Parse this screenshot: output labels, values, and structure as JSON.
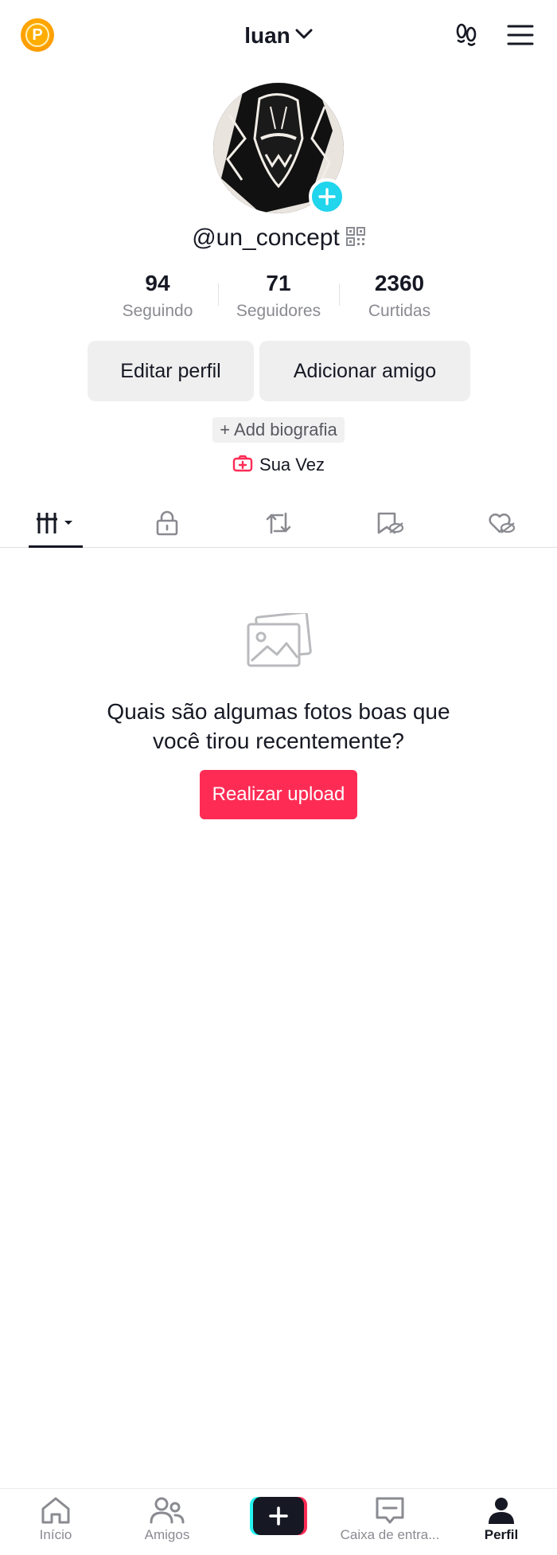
{
  "header": {
    "account_name": "luan",
    "icons": [
      "promo-points-icon",
      "chevron-down-icon",
      "footprints-icon",
      "menu-icon"
    ],
    "promo_letter": "P"
  },
  "profile": {
    "username": "@un_concept",
    "stats": [
      {
        "value": "94",
        "label": "Seguindo"
      },
      {
        "value": "71",
        "label": "Seguidores"
      },
      {
        "value": "2360",
        "label": "Curtidas"
      }
    ],
    "edit_label": "Editar perfil",
    "add_friend_label": "Adicionar amigo",
    "add_bio_label": "+ Add biografia",
    "turn_label": "Sua Vez"
  },
  "tabs": [
    {
      "name": "videos-grid",
      "icon": "grid-bars-icon",
      "active": true
    },
    {
      "name": "private",
      "icon": "lock-icon"
    },
    {
      "name": "reposts",
      "icon": "repost-icon"
    },
    {
      "name": "hidden-favorites",
      "icon": "bookmark-hidden-icon"
    },
    {
      "name": "hidden-liked",
      "icon": "heart-hidden-icon"
    }
  ],
  "empty_state": {
    "title": "Quais são algumas fotos boas que você tirou recentemente?",
    "button_label": "Realizar upload"
  },
  "bottom_nav": {
    "items": [
      {
        "label": "Início",
        "icon": "home-icon"
      },
      {
        "label": "Amigos",
        "icon": "friends-icon"
      },
      {
        "label": "",
        "icon": "plus-icon"
      },
      {
        "label": "Caixa de entra...",
        "icon": "inbox-icon"
      },
      {
        "label": "Perfil",
        "icon": "profile-icon",
        "active": true
      }
    ]
  },
  "colors": {
    "primary_text": "#161823",
    "secondary_text": "#8a8b91",
    "accent": "#fe2c55",
    "cyan": "#20d5ec",
    "button_bg": "#efefef"
  }
}
